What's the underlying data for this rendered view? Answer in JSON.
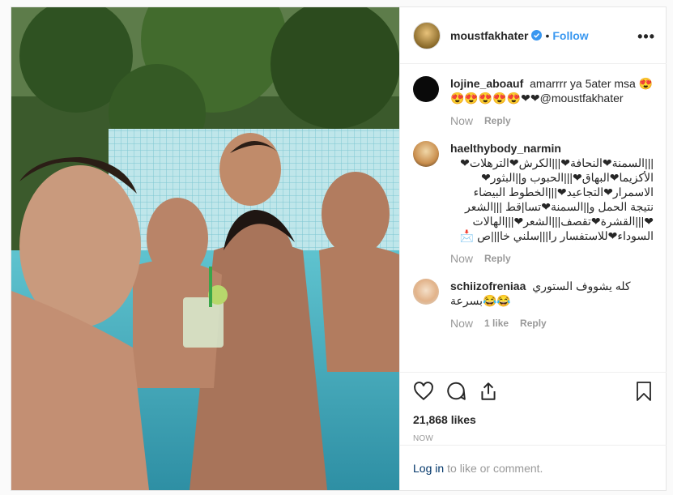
{
  "post": {
    "username": "moustfakhater",
    "follow_label": "Follow",
    "dot": "•",
    "more_label": "•••",
    "likes": "21,868 likes",
    "time": "NOW",
    "login_link": "Log in",
    "login_rest": "to like or comment."
  },
  "comments": [
    {
      "user": "lojine_aboauf",
      "text": "amarrrr ya 5ater msa 😍😍😍😍😍😍❤❤@moustfakhater",
      "time": "Now",
      "likes": "",
      "reply": "Reply"
    },
    {
      "user": "haelthybody_narmin",
      "text": "|||السمنة❤النحافة❤|||الكرش❤الترهلات❤الأكزيما❤البهاق❤|||الحبوب و||البثور❤الاسمرار❤التجاعيد❤|||الخطوط البيضاء نتيجة الحمل و||السمنة❤تسا|قط |||الشعر❤|||القشرة❤تقصف|||الشعر❤|||الهالات السوداء❤للاستفسار را|||سلني خا|||ص 📩",
      "time": "Now",
      "likes": "",
      "reply": "Reply"
    },
    {
      "user": "schiizofreniaa",
      "text": "كله يشووف الستوري بسرعة😂😂",
      "time": "Now",
      "likes": "1 like",
      "reply": "Reply"
    }
  ],
  "colors": {
    "accent": "#3897f0",
    "verified": "#3897f0",
    "link": "#003569",
    "muted": "#999999"
  },
  "icons": [
    "verified-icon",
    "more-icon",
    "heart-icon",
    "comment-icon",
    "share-icon",
    "bookmark-icon"
  ]
}
